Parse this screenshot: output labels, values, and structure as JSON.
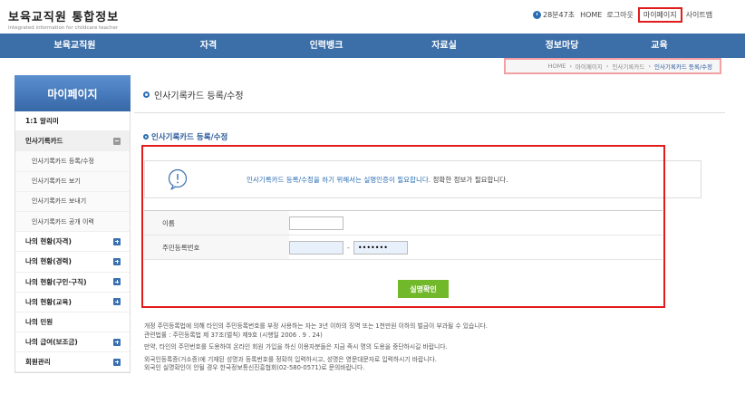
{
  "header": {
    "logo_title": "보육교직원 통합정보",
    "logo_subtitle": "Integrated information for childcare teacher",
    "timer": "28분47초",
    "links": {
      "home": "HOME",
      "logout": "로그아웃",
      "mypage": "마이페이지",
      "sitemap": "사이트맵"
    }
  },
  "nav": [
    "보육교직원",
    "자격",
    "인력뱅크",
    "자료실",
    "정보마당",
    "교육"
  ],
  "breadcrumb": [
    "HOME",
    "마이페이지",
    "인사기록카드",
    "인사기록카드 등록/수정"
  ],
  "sidebar": {
    "title": "마이페이지",
    "items": [
      {
        "label": "1:1 알리미"
      },
      {
        "label": "인사기록카드",
        "expanded": true
      },
      {
        "label": "인사기록카드 등록/수정",
        "sub": true
      },
      {
        "label": "인사기록카드 보기",
        "sub": true
      },
      {
        "label": "인사기록카드 보내기",
        "sub": true
      },
      {
        "label": "인사기록카드 공개 이력",
        "sub": true
      },
      {
        "label": "나의 현황(자격)"
      },
      {
        "label": "나의 현황(경력)"
      },
      {
        "label": "나의 현황(구인·구직)"
      },
      {
        "label": "나의 현황(교육)"
      },
      {
        "label": "나의 민원"
      },
      {
        "label": "나의 급여(보조금)"
      },
      {
        "label": "회원관리"
      }
    ]
  },
  "main": {
    "page_title": "인사기록카드 등록/수정",
    "section_title": "인사기록카드 등록/수정",
    "notice_highlight": "인사기록카드 등록/수정을 하기 위해서는 실명인증이 필요합니다.",
    "notice_rest": " 정확한 정보가 필요합니다.",
    "form": {
      "name_label": "이름",
      "name_value": "",
      "rrn_label": "주민등록번호",
      "rrn_front": "",
      "rrn_back": "•••••••"
    },
    "submit_label": "실명확인",
    "footnotes": [
      "개정 주민등록법에 의해 타인의 주민등록번호를 부정 사용하는 자는 3년 이하의 징역 또는 1천만원 이하의 벌금이 부과될 수 있습니다.",
      "관련법률 : 주민등록법 제 37조(벌칙) 제9호 (시행일 2006 . 9 . 24)",
      "만약, 타인의 주민번호를 도용하여 온라인 회원 가입을 하신 이용자분들은 지금 즉시 명의 도용을 중단하시길 바랍니다.",
      "외국인등록증(거소증)에 기재된 성명과 등록번호를 정확히 입력하시고, 성명은 영문대문자로 입력하시기 바랍니다.",
      "외국인 실명확인이 안될 경우 한국정보통신진흥협회(02-580-0571)로 문의바랍니다."
    ]
  },
  "colors": {
    "nav_bg": "#3c6ea8",
    "accent": "#2a6db2",
    "button": "#72b82b",
    "highlight_frame": "#e21b1b"
  }
}
